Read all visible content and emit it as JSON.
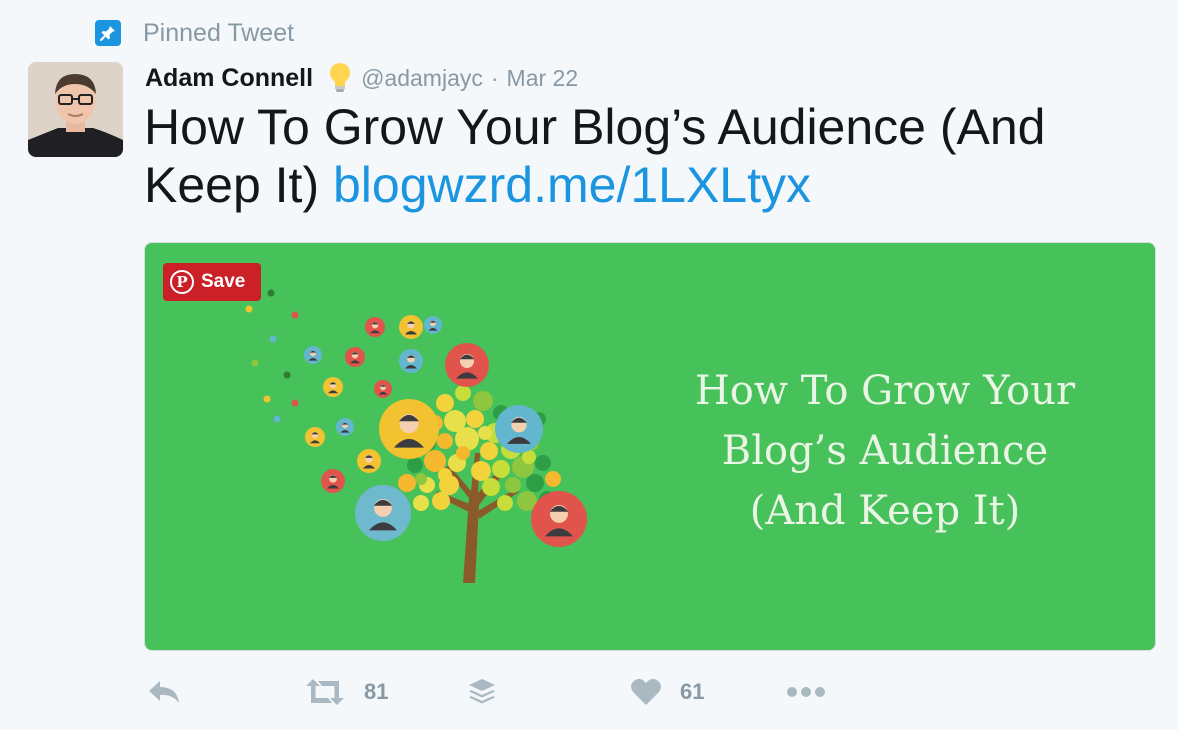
{
  "pinned": {
    "label": "Pinned Tweet",
    "icon": "pin-icon"
  },
  "author": {
    "name": "Adam Connell",
    "badge_icon": "lightbulb-icon",
    "handle": "@adamjayc",
    "separator": "·",
    "date": "Mar 22"
  },
  "tweet": {
    "text": "How To Grow Your Blog’s Audience (And Keep It) ",
    "link": "blogwzrd.me/1LXLtyx"
  },
  "media": {
    "save_button": "Save",
    "pinterest_glyph": "P",
    "title_lines": [
      "How To Grow Your",
      "Blog’s Audience",
      "(And Keep It)"
    ],
    "background_color": "#47c15a"
  },
  "actions": {
    "reply": {
      "icon": "reply-icon"
    },
    "retweet": {
      "icon": "retweet-icon",
      "count": "81"
    },
    "buffer": {
      "icon": "buffer-stack-icon"
    },
    "like": {
      "icon": "heart-icon",
      "count": "61"
    },
    "more": {
      "icon": "more-dots-icon"
    }
  },
  "colors": {
    "link": "#1b95e0",
    "muted": "#8899a6",
    "pin_blue": "#1b95e0",
    "pinterest_red": "#cb2027"
  }
}
